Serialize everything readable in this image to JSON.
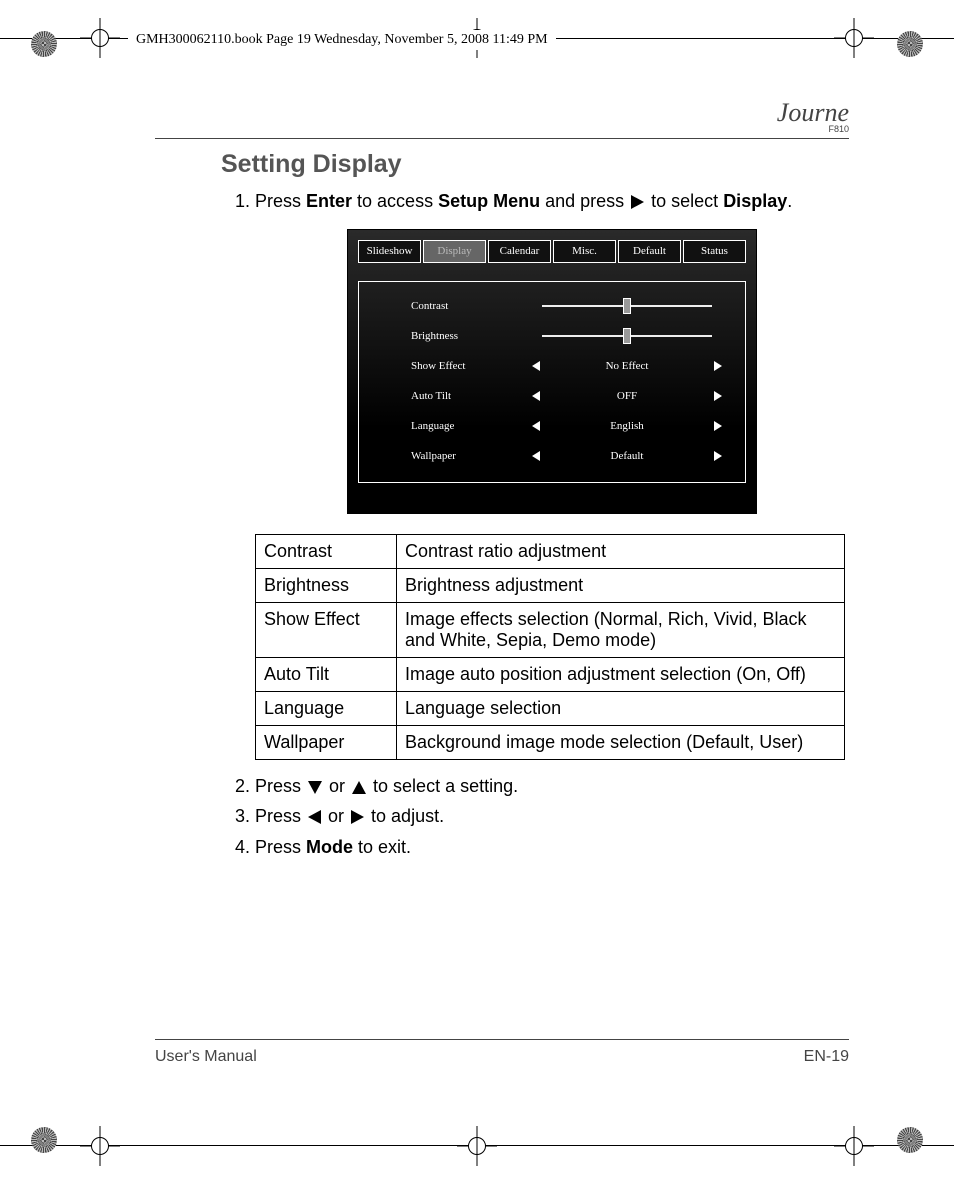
{
  "page_meta": "GMH300062110.book  Page 19  Wednesday, November 5, 2008  11:49 PM",
  "brand": {
    "name": "Journe",
    "model": "F810"
  },
  "section_title": "Setting Display",
  "steps": {
    "s1_a": "Press ",
    "s1_b": "Enter",
    "s1_c": " to access ",
    "s1_d": "Setup Menu",
    "s1_e": " and press ",
    "s1_f": " to select ",
    "s1_g": "Display",
    "s1_h": ".",
    "s2_a": "Press ",
    "s2_b": " or ",
    "s2_c": " to select a setting.",
    "s3_a": "Press ",
    "s3_b": " or ",
    "s3_c": " to adjust.",
    "s4_a": "Press ",
    "s4_b": "Mode",
    "s4_c": " to exit."
  },
  "menu": {
    "tabs": [
      "Slideshow",
      "Display",
      "Calendar",
      "Misc.",
      "Default",
      "Status"
    ],
    "active_tab": "Display",
    "rows": [
      {
        "label": "Contrast",
        "type": "slider"
      },
      {
        "label": "Brightness",
        "type": "slider"
      },
      {
        "label": "Show Effect",
        "type": "spinner",
        "value": "No Effect"
      },
      {
        "label": "Auto Tilt",
        "type": "spinner",
        "value": "OFF"
      },
      {
        "label": "Language",
        "type": "spinner",
        "value": "English"
      },
      {
        "label": "Wallpaper",
        "type": "spinner",
        "value": "Default"
      }
    ]
  },
  "table": [
    {
      "name": "Contrast",
      "desc": "Contrast ratio adjustment"
    },
    {
      "name": "Brightness",
      "desc": "Brightness adjustment"
    },
    {
      "name": "Show Effect",
      "desc": "Image effects selection (Normal, Rich, Vivid, Black and White, Sepia, Demo mode)"
    },
    {
      "name": "Auto Tilt",
      "desc": "Image auto position adjustment selection (On, Off)"
    },
    {
      "name": "Language",
      "desc": "Language selection"
    },
    {
      "name": "Wallpaper",
      "desc": "Background image mode selection (Default, User)"
    }
  ],
  "footer": {
    "left": "User's Manual",
    "right": "EN-19"
  }
}
